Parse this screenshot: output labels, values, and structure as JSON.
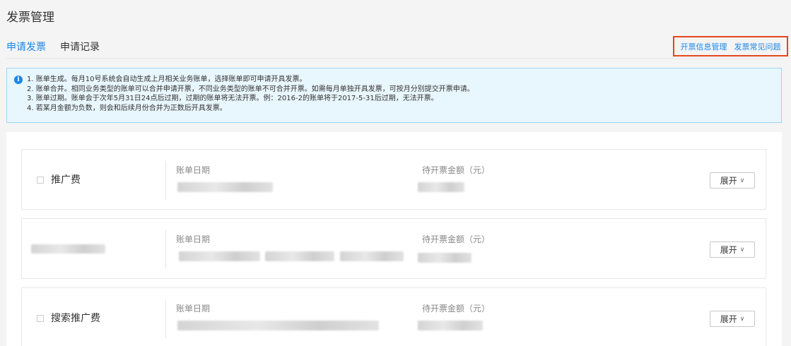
{
  "page": {
    "title": "发票管理"
  },
  "tabs": [
    {
      "label": "申请发票",
      "active": true
    },
    {
      "label": "申请记录",
      "active": false
    }
  ],
  "quick_links": [
    {
      "label": "开票信息管理"
    },
    {
      "label": "发票常见问题"
    }
  ],
  "notice": {
    "icon": "info-icon",
    "icon_glyph": "i",
    "lines": [
      "1. 账单生成。每月10号系统会自动生成上月相关业务账单，选择账单即可申请开具发票。",
      "2. 账单合并。相同业务类型的账单可以合并申请开票，不同业务类型的账单不可合并开票。如需每月单独开具发票，可按月分别提交开票申请。",
      "3. 账单过期。账单会于次年5月31日24点后过期，过期的账单将无法开票。例：2016-2的账单将于2017-5-31后过期，无法开票。",
      "4. 若某月金额为负数，则会和后续月份合并为正数后开具发票。"
    ]
  },
  "bills": [
    {
      "name": "推广费",
      "date_label": "账单日期",
      "amount_label": "待开票金额（元）",
      "expand_label": "展开",
      "name_hidden": false
    },
    {
      "name": "",
      "date_label": "账单日期",
      "amount_label": "待开票金额（元）",
      "expand_label": "展开",
      "name_hidden": true
    },
    {
      "name": "搜索推广费",
      "date_label": "账单日期",
      "amount_label": "待开票金额（元）",
      "expand_label": "展开",
      "name_hidden": false
    }
  ],
  "colors": {
    "accent": "#1a86e8",
    "highlight_border": "#e4461b",
    "notice_bg": "#e8f6fd"
  }
}
